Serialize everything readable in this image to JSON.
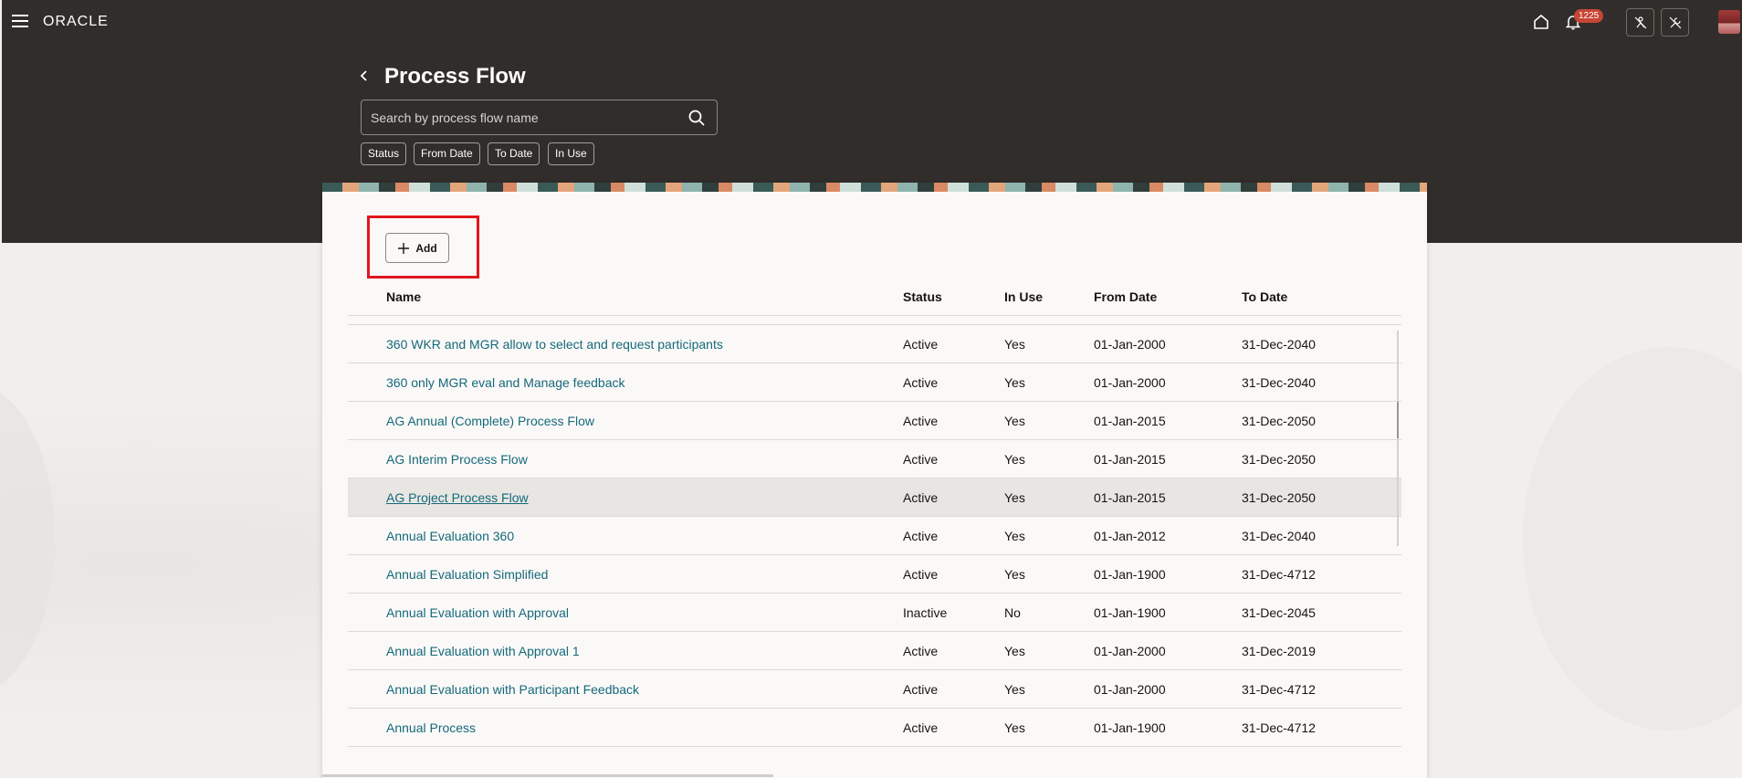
{
  "global": {
    "brand": "ORACLE",
    "notification_count": "1225"
  },
  "page": {
    "title": "Process Flow",
    "search_placeholder": "Search by process flow name",
    "filters": [
      "Status",
      "From Date",
      "To Date",
      "In Use"
    ]
  },
  "toolbar": {
    "add_label": "Add"
  },
  "table": {
    "columns": [
      "Name",
      "Status",
      "In Use",
      "From Date",
      "To Date"
    ],
    "rows": [
      {
        "name": "360 WKR and MGR allow to select and request participants",
        "status": "Active",
        "in_use": "Yes",
        "from": "01-Jan-2000",
        "to": "31-Dec-2040"
      },
      {
        "name": "360 only MGR eval and Manage feedback",
        "status": "Active",
        "in_use": "Yes",
        "from": "01-Jan-2000",
        "to": "31-Dec-2040"
      },
      {
        "name": "AG Annual (Complete) Process Flow",
        "status": "Active",
        "in_use": "Yes",
        "from": "01-Jan-2015",
        "to": "31-Dec-2050"
      },
      {
        "name": "AG Interim Process Flow",
        "status": "Active",
        "in_use": "Yes",
        "from": "01-Jan-2015",
        "to": "31-Dec-2050"
      },
      {
        "name": "AG Project Process Flow",
        "status": "Active",
        "in_use": "Yes",
        "from": "01-Jan-2015",
        "to": "31-Dec-2050"
      },
      {
        "name": "Annual Evaluation 360",
        "status": "Active",
        "in_use": "Yes",
        "from": "01-Jan-2012",
        "to": "31-Dec-2040"
      },
      {
        "name": "Annual Evaluation Simplified",
        "status": "Active",
        "in_use": "Yes",
        "from": "01-Jan-1900",
        "to": "31-Dec-4712"
      },
      {
        "name": "Annual Evaluation with Approval",
        "status": "Inactive",
        "in_use": "No",
        "from": "01-Jan-1900",
        "to": "31-Dec-2045"
      },
      {
        "name": "Annual Evaluation with Approval 1",
        "status": "Active",
        "in_use": "Yes",
        "from": "01-Jan-2000",
        "to": "31-Dec-2019"
      },
      {
        "name": "Annual Evaluation with Participant Feedback",
        "status": "Active",
        "in_use": "Yes",
        "from": "01-Jan-2000",
        "to": "31-Dec-4712"
      },
      {
        "name": "Annual Process",
        "status": "Active",
        "in_use": "Yes",
        "from": "01-Jan-1900",
        "to": "31-Dec-4712"
      }
    ]
  },
  "icons": {
    "menu": "hamburger-menu-icon",
    "home": "home-icon",
    "notifications": "bell-icon",
    "search": "search-icon",
    "back": "chevron-left-icon",
    "add": "plus-icon"
  },
  "colors": {
    "header_bg": "#312d2a",
    "link": "#15697a",
    "badge": "#c74634",
    "highlight": "#e0161d"
  }
}
